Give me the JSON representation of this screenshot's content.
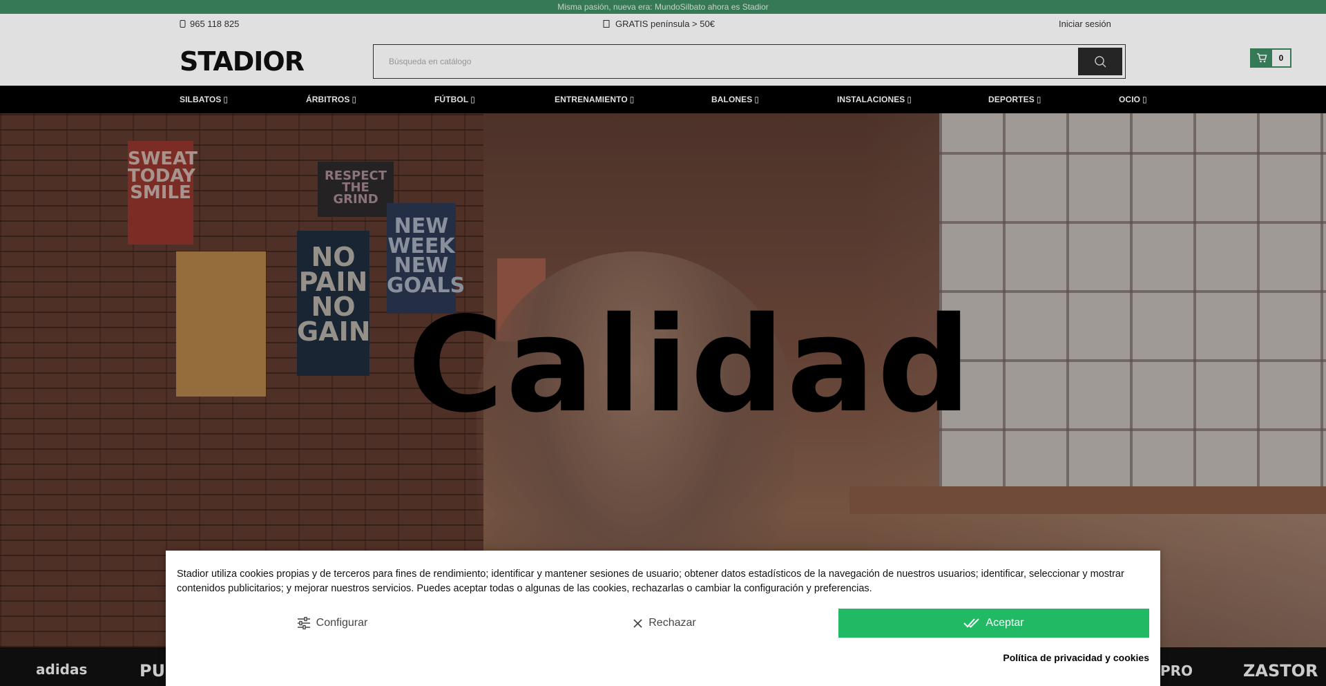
{
  "announcement": "Misma pasión, nueva era: MundoSilbato ahora es Stadior",
  "topbar": {
    "phone": "965 118 825",
    "shipping": "GRATIS península > 50€",
    "login": "Iniciar sesión"
  },
  "logo": "STADIOR",
  "search": {
    "placeholder": "Búsqueda en catálogo"
  },
  "cart": {
    "count": "0"
  },
  "nav": [
    {
      "label": "SILBATOS"
    },
    {
      "label": "ÁRBITROS"
    },
    {
      "label": "FÚTBOL"
    },
    {
      "label": "ENTRENAMIENTO"
    },
    {
      "label": "BALONES"
    },
    {
      "label": "INSTALACIONES"
    },
    {
      "label": "DEPORTES"
    },
    {
      "label": "OCIO"
    }
  ],
  "hero": {
    "title": "Calidad",
    "posters": [
      "SWEAT TODAY SMILE",
      "NO PAIN NO GAIN",
      "NEW WEEK NEW GOALS",
      "RESPECT THE GRIND"
    ]
  },
  "brands": [
    "adidas",
    "PUMA",
    "PRO",
    "ZASTOR"
  ],
  "cookie": {
    "text": "Stadior utiliza cookies propias y de terceros para fines de rendimiento; identificar y mantener sesiones de usuario; obtener datos estadísticos de la navegación de nuestros usuarios; identificar, seleccionar y mostrar contenidos publicitarios; y mejorar nuestros servicios. Puedes aceptar todas o algunas de las cookies, rechazarlas o cambiar la configuración y preferencias.",
    "configure": "Configurar",
    "reject": "Rechazar",
    "accept": "Aceptar",
    "policy": "Política de privacidad y cookies"
  },
  "colors": {
    "brand_green": "#3d8a63",
    "accept_green": "#22b965",
    "nav_bg": "#000000"
  }
}
